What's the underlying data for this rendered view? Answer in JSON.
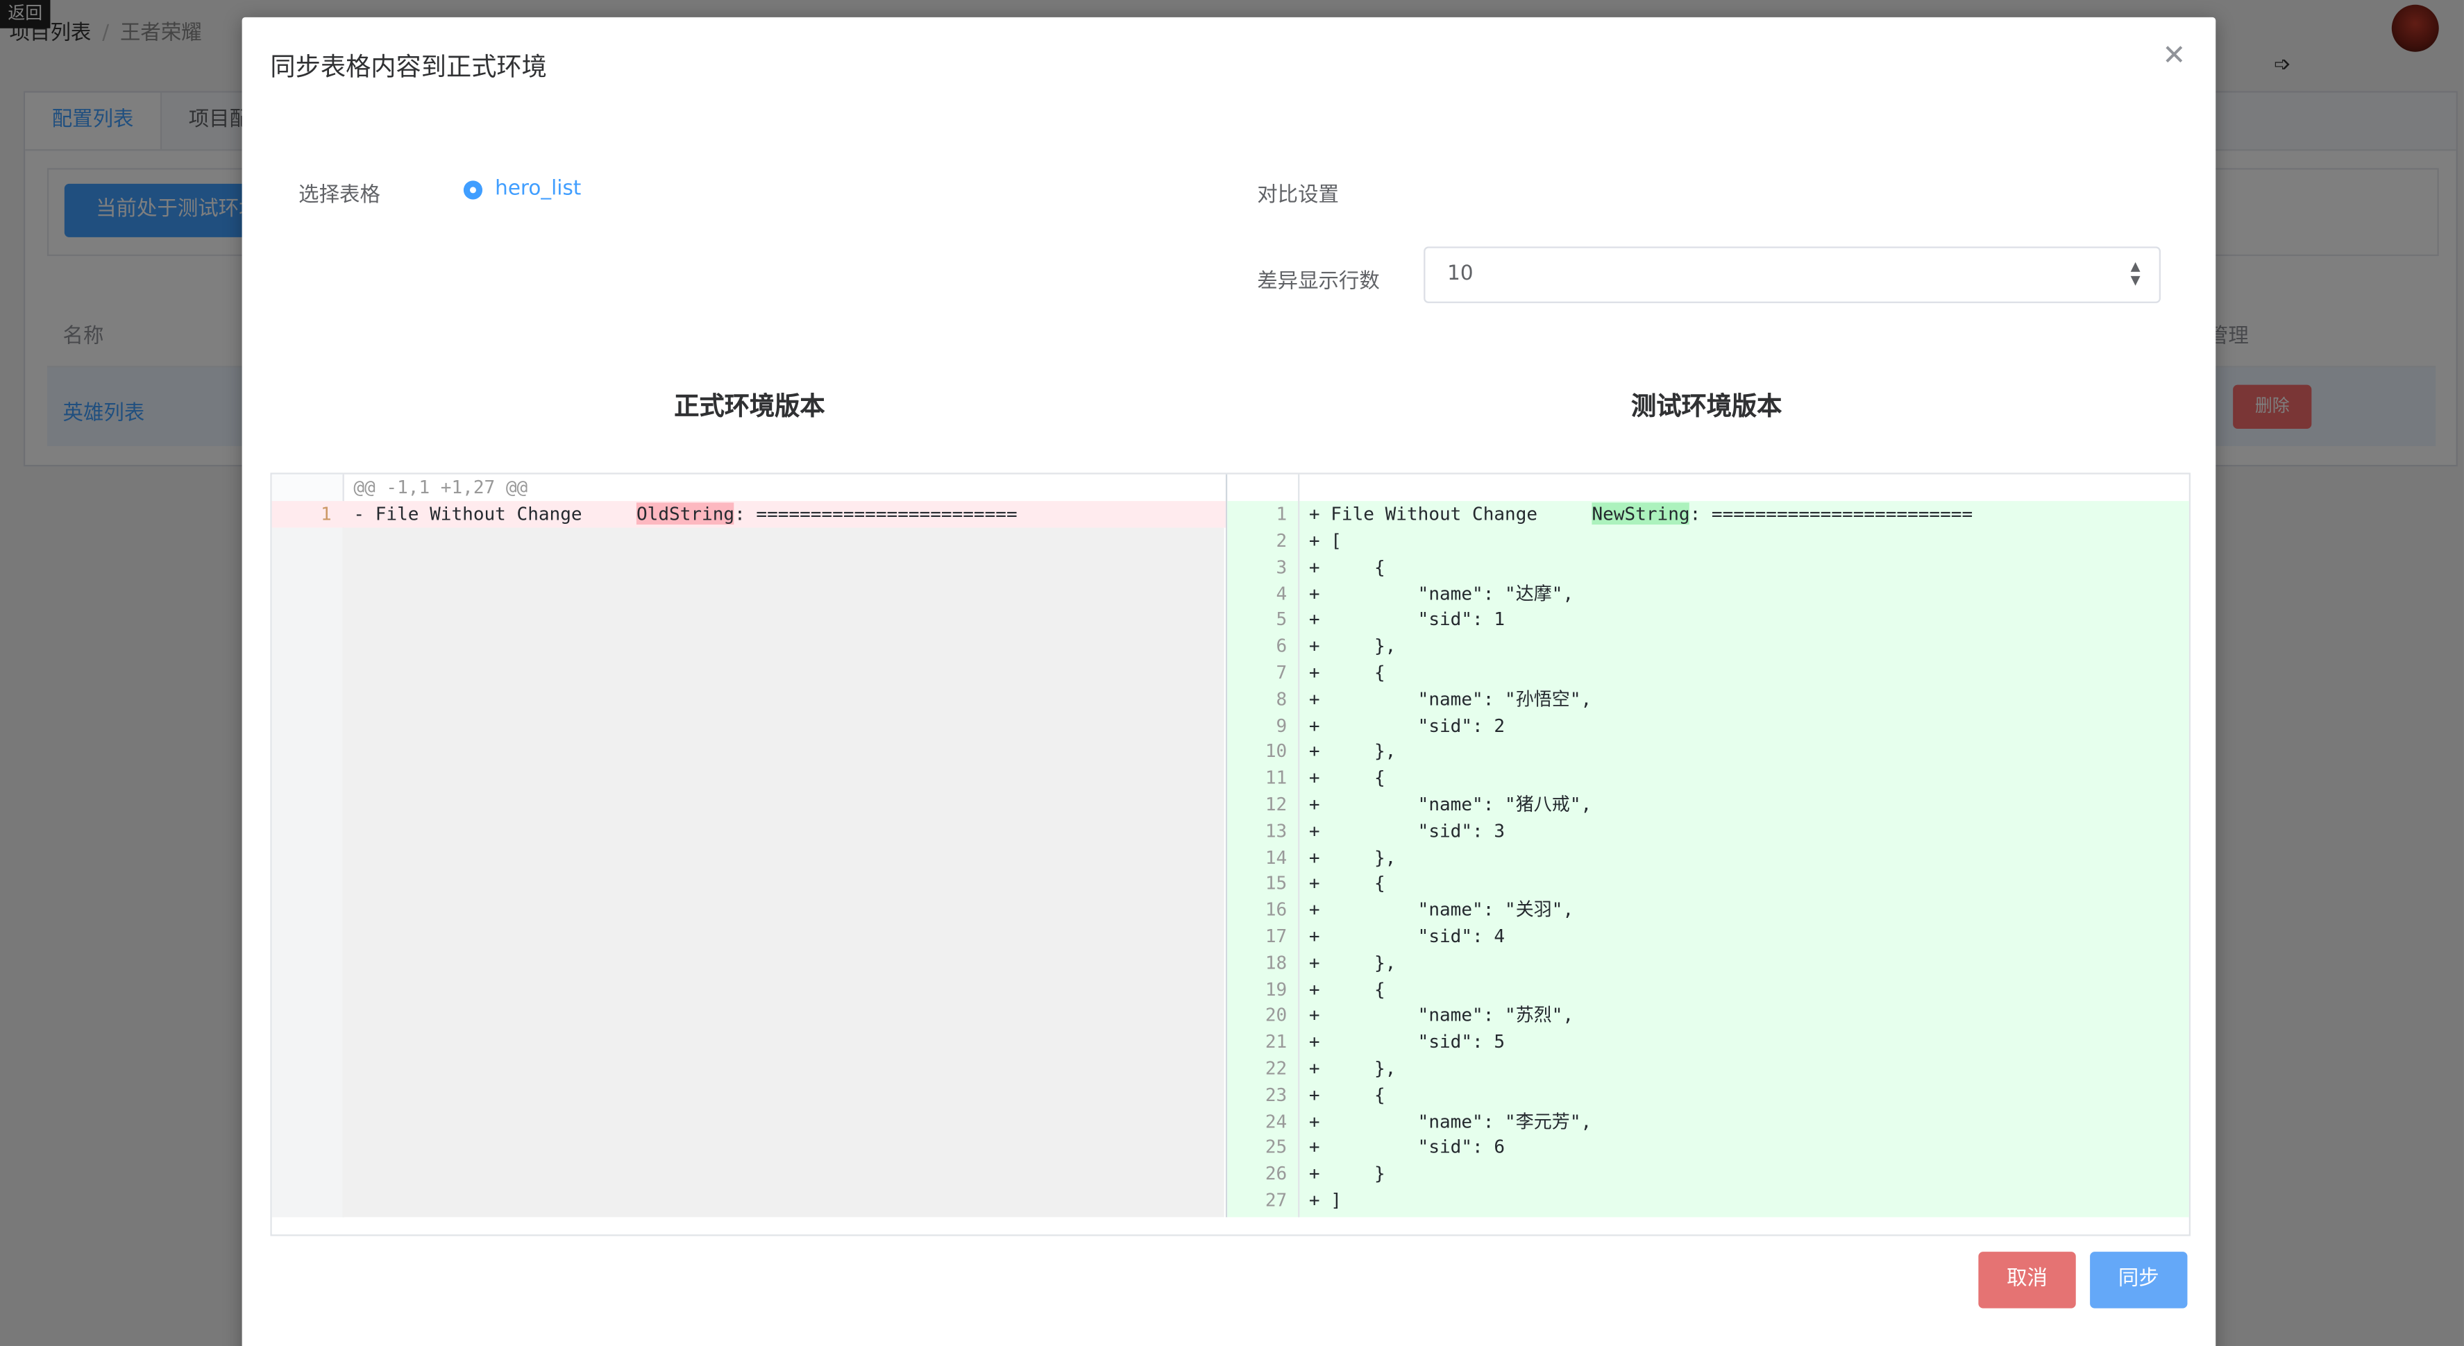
{
  "background": {
    "back_tag": "返回",
    "breadcrumb": [
      "项目列表",
      "王者荣耀"
    ],
    "tabs": [
      "配置列表",
      "项目配"
    ],
    "env_button": "当前处于测试环境",
    "table_headers": [
      "名称",
      "管理"
    ],
    "table_row_name": "英雄列表",
    "delete_label": "删除"
  },
  "dialog": {
    "title": "同步表格内容到正式环境",
    "select_table_label": "选择表格",
    "table_option": "hero_list",
    "compare_settings_label": "对比设置",
    "diff_lines_label": "差异显示行数",
    "diff_lines_value": "10",
    "prod_version_title": "正式环境版本",
    "test_version_title": "测试环境版本",
    "cancel_label": "取消",
    "sync_label": "同步"
  },
  "diff": {
    "hunk_header": "@@ -1,1 +1,27 @@",
    "left": {
      "line_number": "1",
      "prefix": "- File Without Change",
      "highlight": "OldString",
      "suffix": ": ========================"
    },
    "right_header": {
      "prefix": "+ File Without Change",
      "highlight": "NewString",
      "suffix": ": ========================"
    },
    "right_lines": [
      "+ [",
      "+     {",
      "+         \"name\": \"达摩\",",
      "+         \"sid\": 1",
      "+     },",
      "+     {",
      "+         \"name\": \"孙悟空\",",
      "+         \"sid\": 2",
      "+     },",
      "+     {",
      "+         \"name\": \"猪八戒\",",
      "+         \"sid\": 3",
      "+     },",
      "+     {",
      "+         \"name\": \"关羽\",",
      "+         \"sid\": 4",
      "+     },",
      "+     {",
      "+         \"name\": \"苏烈\",",
      "+         \"sid\": 5",
      "+     },",
      "+     {",
      "+         \"name\": \"李元芳\",",
      "+         \"sid\": 6",
      "+     }",
      "+ ]"
    ]
  }
}
